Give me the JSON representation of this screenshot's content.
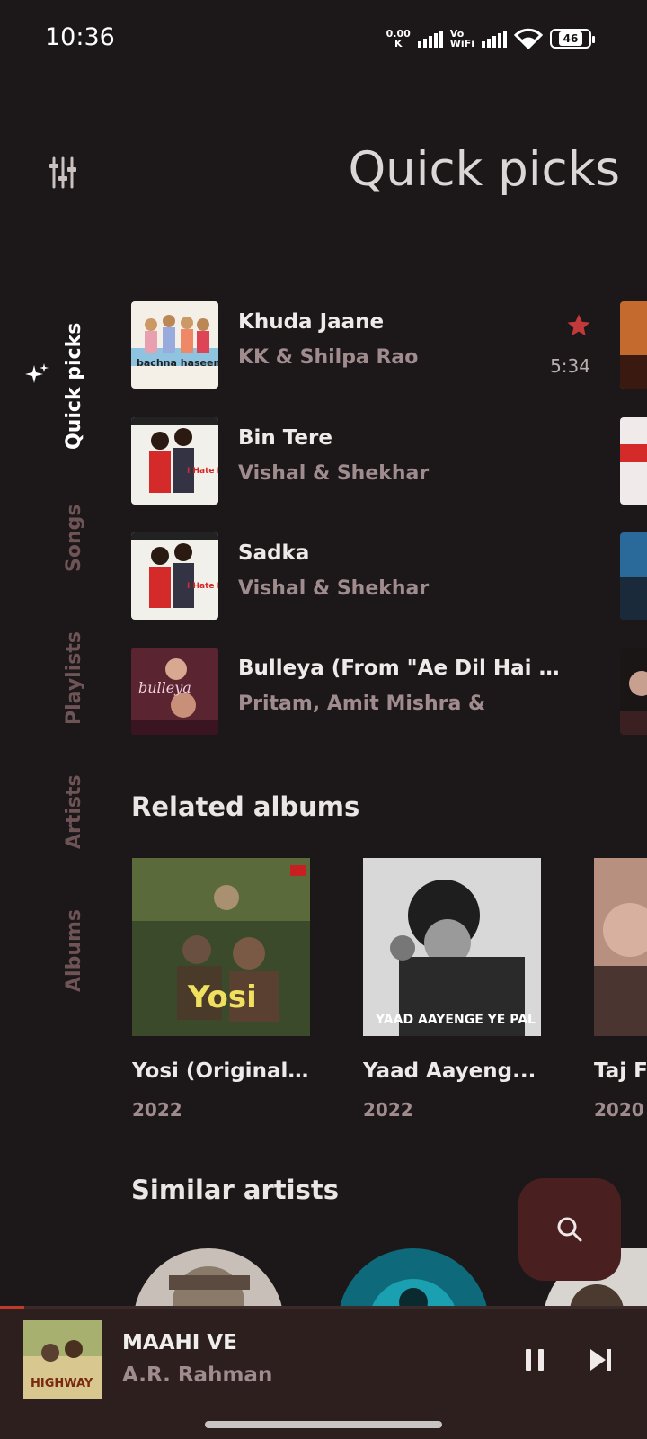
{
  "status_bar": {
    "time": "10:36",
    "net_speed_value": "0.00",
    "net_speed_unit": "K",
    "vowifi_top": "Vo",
    "vowifi_bottom": "WiFi",
    "battery": "46"
  },
  "header": {
    "title": "Quick picks",
    "settings_icon": "equalizer-sliders-icon"
  },
  "rail": {
    "items": [
      {
        "label": "Quick picks",
        "active": true
      },
      {
        "label": "Songs",
        "active": false
      },
      {
        "label": "Playlists",
        "active": false
      },
      {
        "label": "Artists",
        "active": false
      },
      {
        "label": "Albums",
        "active": false
      }
    ]
  },
  "songs": [
    {
      "title": "Khuda Jaane",
      "artist": "KK & Shilpa Rao",
      "duration": "5:34",
      "favorite": true,
      "cover_text": "bachna haseeno"
    },
    {
      "title": "Bin Tere",
      "artist": "Vishal & Shekhar",
      "cover_text": "I Hate LUV"
    },
    {
      "title": "Sadka",
      "artist": "Vishal & Shekhar",
      "cover_text": "I Hate LUV"
    },
    {
      "title": "Bulleya (From \"Ae Dil Hai M...",
      "artist": "Pritam, Amit Mishra &",
      "cover_text": "bulleya"
    }
  ],
  "related_albums": {
    "title": "Related albums",
    "items": [
      {
        "name": "Yosi (Original ...",
        "year": "2022",
        "cover_text": "Yosi"
      },
      {
        "name": "Yaad Aayeng...",
        "year": "2022",
        "cover_text": "YAAD AAYENGE YE PAL"
      },
      {
        "name": "Taj F",
        "year": "2020"
      }
    ]
  },
  "similar_artists": {
    "title": "Similar artists"
  },
  "mini_player": {
    "title": "MAAHI VE",
    "artist": "A.R. Rahman",
    "cover_text": "HIGHWAY",
    "progress": 0.038
  },
  "colors": {
    "accent": "#c0392b",
    "background": "#1c1819",
    "fab": "#4a1f1f",
    "player": "#2e1f1f"
  }
}
